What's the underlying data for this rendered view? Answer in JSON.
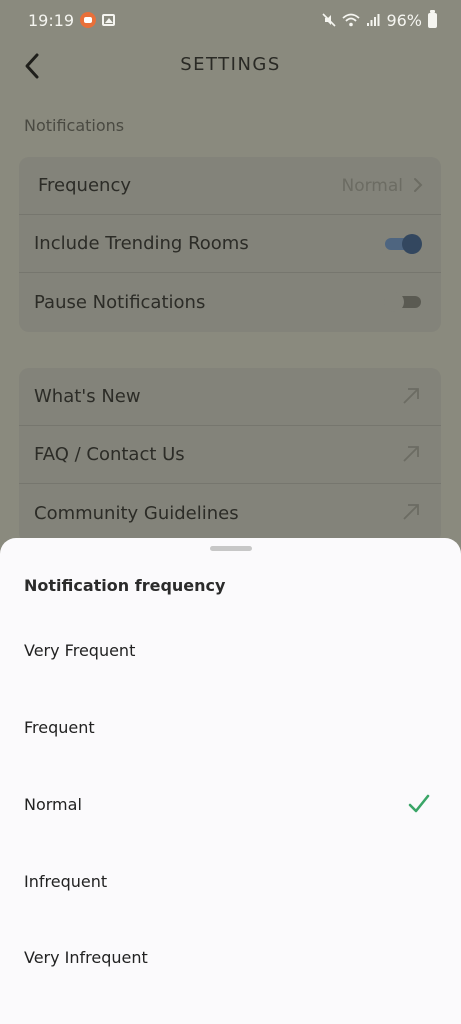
{
  "status_bar": {
    "time": "19:19",
    "battery": "96%"
  },
  "header": {
    "title": "SETTINGS"
  },
  "notifications_section": {
    "title": "Notifications",
    "rows": [
      {
        "label": "Frequency",
        "value": "Normal"
      },
      {
        "label": "Include Trending Rooms",
        "toggle": true
      },
      {
        "label": "Pause Notifications",
        "toggle": false
      }
    ]
  },
  "links": [
    {
      "label": "What's New"
    },
    {
      "label": "FAQ / Contact Us"
    },
    {
      "label": "Community Guidelines"
    }
  ],
  "sheet": {
    "title": "Notification frequency",
    "options": [
      {
        "label": "Very Frequent",
        "selected": false
      },
      {
        "label": "Frequent",
        "selected": false
      },
      {
        "label": "Normal",
        "selected": true
      },
      {
        "label": "Infrequent",
        "selected": false
      },
      {
        "label": "Very Infrequent",
        "selected": false
      }
    ]
  },
  "colors": {
    "toggle_on": "#33475f",
    "check": "#3aa567"
  }
}
